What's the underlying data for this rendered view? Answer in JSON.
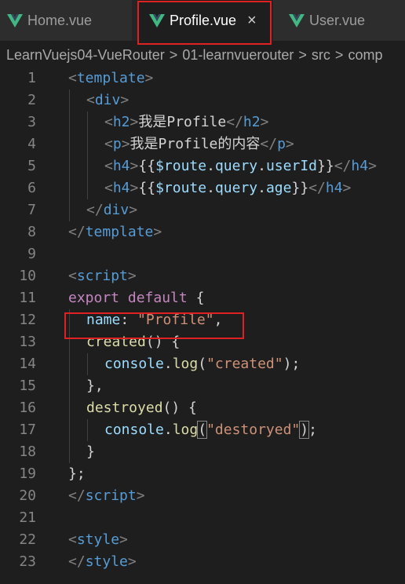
{
  "tabs": [
    {
      "label": "Home.vue",
      "active": false
    },
    {
      "label": "Profile.vue",
      "active": true,
      "close": "×"
    },
    {
      "label": "User.vue",
      "active": false
    }
  ],
  "breadcrumb": [
    "LearnVuejs04-VueRouter",
    "01-learnvuerouter",
    "src",
    "comp"
  ],
  "breadcrumb_sep": ">",
  "colors": {
    "vue_green": "#41b883",
    "highlight_red": "#e02121",
    "editor_bg": "#1e1e1e"
  },
  "lines": [
    {
      "n": "1",
      "indent": 0,
      "tokens": [
        [
          "br",
          "<"
        ],
        [
          "tag",
          "template"
        ],
        [
          "br",
          ">"
        ]
      ]
    },
    {
      "n": "2",
      "indent": 1,
      "tokens": [
        [
          "br",
          "<"
        ],
        [
          "tag",
          "div"
        ],
        [
          "br",
          ">"
        ]
      ]
    },
    {
      "n": "3",
      "indent": 2,
      "tokens": [
        [
          "br",
          "<"
        ],
        [
          "tag",
          "h2"
        ],
        [
          "br",
          ">"
        ],
        [
          "txt",
          "我是Profile"
        ],
        [
          "br",
          "</"
        ],
        [
          "tag",
          "h2"
        ],
        [
          "br",
          ">"
        ]
      ]
    },
    {
      "n": "4",
      "indent": 2,
      "tokens": [
        [
          "br",
          "<"
        ],
        [
          "tag",
          "p"
        ],
        [
          "br",
          ">"
        ],
        [
          "txt",
          "我是Profile的内容"
        ],
        [
          "br",
          "</"
        ],
        [
          "tag",
          "p"
        ],
        [
          "br",
          ">"
        ]
      ]
    },
    {
      "n": "5",
      "indent": 2,
      "tokens": [
        [
          "br",
          "<"
        ],
        [
          "tag",
          "h4"
        ],
        [
          "br",
          ">"
        ],
        [
          "txt",
          "{{"
        ],
        [
          "var",
          "$route"
        ],
        [
          "txt",
          "."
        ],
        [
          "var",
          "query"
        ],
        [
          "txt",
          "."
        ],
        [
          "var",
          "userId"
        ],
        [
          "txt",
          "}}"
        ],
        [
          "br",
          "</"
        ],
        [
          "tag",
          "h4"
        ],
        [
          "br",
          ">"
        ]
      ]
    },
    {
      "n": "6",
      "indent": 2,
      "tokens": [
        [
          "br",
          "<"
        ],
        [
          "tag",
          "h4"
        ],
        [
          "br",
          ">"
        ],
        [
          "txt",
          "{{"
        ],
        [
          "var",
          "$route"
        ],
        [
          "txt",
          "."
        ],
        [
          "var",
          "query"
        ],
        [
          "txt",
          "."
        ],
        [
          "var",
          "age"
        ],
        [
          "txt",
          "}}"
        ],
        [
          "br",
          "</"
        ],
        [
          "tag",
          "h4"
        ],
        [
          "br",
          ">"
        ]
      ]
    },
    {
      "n": "7",
      "indent": 1,
      "tokens": [
        [
          "br",
          "</"
        ],
        [
          "tag",
          "div"
        ],
        [
          "br",
          ">"
        ]
      ]
    },
    {
      "n": "8",
      "indent": 0,
      "tokens": [
        [
          "br",
          "</"
        ],
        [
          "tag",
          "template"
        ],
        [
          "br",
          ">"
        ]
      ]
    },
    {
      "n": "9",
      "indent": 0,
      "tokens": []
    },
    {
      "n": "10",
      "indent": 0,
      "tokens": [
        [
          "br",
          "<"
        ],
        [
          "tag",
          "script"
        ],
        [
          "br",
          ">"
        ]
      ]
    },
    {
      "n": "11",
      "indent": 0,
      "tokens": [
        [
          "kw",
          "export"
        ],
        [
          "plain",
          " "
        ],
        [
          "kw",
          "default"
        ],
        [
          "plain",
          " {"
        ]
      ]
    },
    {
      "n": "12",
      "indent": 1,
      "tokens": [
        [
          "var",
          "name"
        ],
        [
          "plain",
          ": "
        ],
        [
          "str",
          "\"Profile\""
        ],
        [
          "plain",
          ","
        ]
      ]
    },
    {
      "n": "13",
      "indent": 1,
      "tokens": [
        [
          "fn",
          "created"
        ],
        [
          "plain",
          "() {"
        ]
      ]
    },
    {
      "n": "14",
      "indent": 2,
      "tokens": [
        [
          "var",
          "console"
        ],
        [
          "plain",
          "."
        ],
        [
          "fn",
          "log"
        ],
        [
          "plain",
          "("
        ],
        [
          "str",
          "\"created\""
        ],
        [
          "plain",
          ");"
        ]
      ]
    },
    {
      "n": "15",
      "indent": 1,
      "tokens": [
        [
          "plain",
          "},"
        ]
      ]
    },
    {
      "n": "16",
      "indent": 1,
      "tokens": [
        [
          "fn",
          "destroyed"
        ],
        [
          "plain",
          "() {"
        ]
      ]
    },
    {
      "n": "17",
      "indent": 2,
      "tokens": [
        [
          "var",
          "console"
        ],
        [
          "plain",
          "."
        ],
        [
          "fn",
          "log"
        ],
        [
          "box",
          "("
        ],
        [
          "str",
          "\"destoryed\""
        ],
        [
          "box",
          ")"
        ],
        [
          "plain",
          ";"
        ]
      ]
    },
    {
      "n": "18",
      "indent": 1,
      "tokens": [
        [
          "plain",
          "}"
        ]
      ]
    },
    {
      "n": "19",
      "indent": 0,
      "tokens": [
        [
          "plain",
          "};"
        ]
      ]
    },
    {
      "n": "20",
      "indent": 0,
      "tokens": [
        [
          "br",
          "</"
        ],
        [
          "tag",
          "script"
        ],
        [
          "br",
          ">"
        ]
      ]
    },
    {
      "n": "21",
      "indent": 0,
      "tokens": []
    },
    {
      "n": "22",
      "indent": 0,
      "tokens": [
        [
          "br",
          "<"
        ],
        [
          "tag",
          "style"
        ],
        [
          "br",
          ">"
        ]
      ]
    },
    {
      "n": "23",
      "indent": 0,
      "tokens": [
        [
          "br",
          "</"
        ],
        [
          "tag",
          "style"
        ],
        [
          "br",
          ">"
        ]
      ]
    }
  ]
}
